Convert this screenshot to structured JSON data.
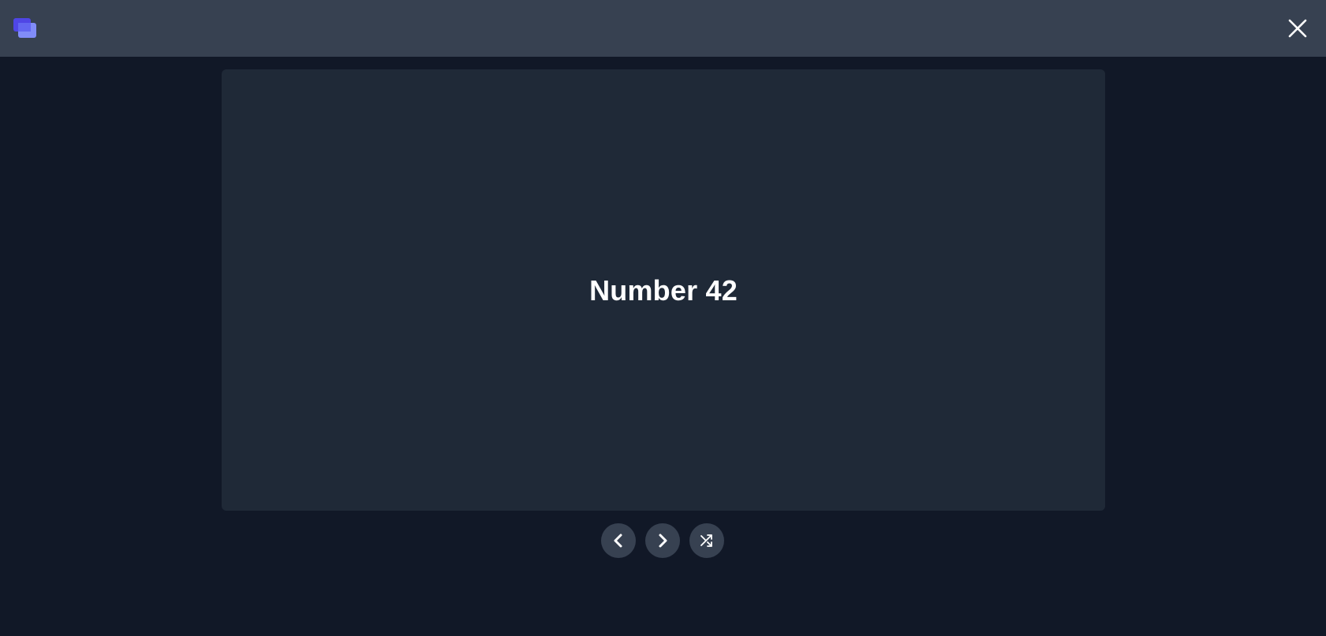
{
  "header": {
    "logo_icon": "stacked-cards-icon",
    "close_icon": "close-icon",
    "accent_color": "#6366f1"
  },
  "card": {
    "text": "Number 42"
  },
  "controls": {
    "prev_icon": "chevron-left-icon",
    "next_icon": "chevron-right-icon",
    "shuffle_icon": "shuffle-icon"
  },
  "colors": {
    "page_background": "#111827",
    "header_background": "#374151",
    "card_background": "#1f2937",
    "button_background": "#374151",
    "text": "#ffffff"
  }
}
